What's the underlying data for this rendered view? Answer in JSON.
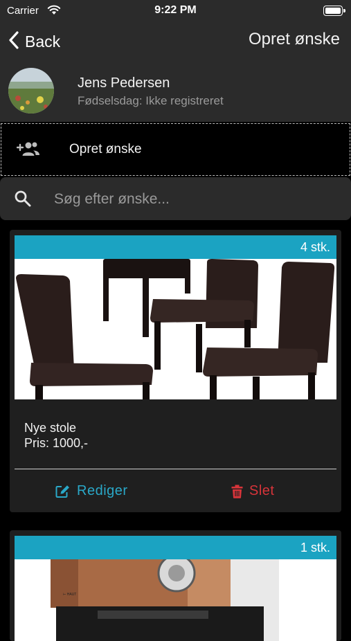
{
  "status_bar": {
    "carrier": "Carrier",
    "time": "9:22 PM"
  },
  "nav": {
    "back_label": "Back",
    "title": "Opret ønske"
  },
  "profile": {
    "name": "Jens Pedersen",
    "birthday": "Fødselsdag: Ikke registreret"
  },
  "create": {
    "label": "Opret ønske"
  },
  "search": {
    "placeholder": "Søg efter ønske..."
  },
  "wishes": [
    {
      "quantity": "4 stk.",
      "name": "Nye stole",
      "price": "Pris: 1000,-",
      "edit_label": "Rediger",
      "delete_label": "Slet"
    },
    {
      "quantity": "1 stk."
    }
  ],
  "colors": {
    "accent": "#1ba3c2",
    "edit": "#2aa8c8",
    "delete": "#d8343a",
    "bar": "#2b2b2b"
  }
}
